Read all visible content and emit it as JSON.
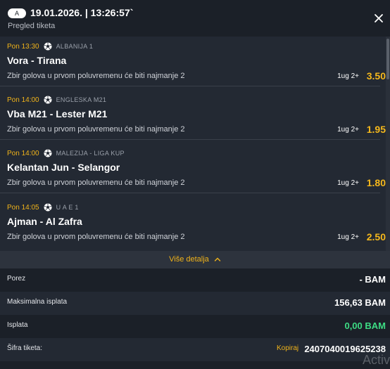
{
  "header": {
    "badge": "A",
    "datetime": "19.01.2026. | 13:26:57`",
    "subtitle": "Pregled tiketa"
  },
  "matches": [
    {
      "time": "Pon 13:30",
      "league": "ALBANIJA 1",
      "teams": "Vora - Tirana",
      "market": "Zbir golova u prvom poluvremenu će biti najmanje 2",
      "pick": "1ug 2+",
      "odd": "3.50"
    },
    {
      "time": "Pon 14:00",
      "league": "ENGLESKA M21",
      "teams": "Vba M21 - Lester M21",
      "market": "Zbir golova u prvom poluvremenu će biti najmanje 2",
      "pick": "1ug 2+",
      "odd": "1.95"
    },
    {
      "time": "Pon 14:00",
      "league": "MALEZIJA - LIGA KUP",
      "teams": "Kelantan Jun - Selangor",
      "market": "Zbir golova u prvom poluvremenu će biti najmanje 2",
      "pick": "1ug 2+",
      "odd": "1.80"
    },
    {
      "time": "Pon 14:05",
      "league": "U A E 1",
      "teams": "Ajman - Al Zafra",
      "market": "Zbir golova u prvom poluvremenu će biti najmanje 2",
      "pick": "1ug 2+",
      "odd": "2.50"
    }
  ],
  "details": {
    "label": "Više detalja"
  },
  "summary": {
    "tax_label": "Porez",
    "tax_value": "- BAM",
    "max_payout_label": "Maksimalna isplata",
    "max_payout_value": "156,63 BAM",
    "payout_label": "Isplata",
    "payout_value": "0,00 BAM",
    "code_label": "Šifra tiketa:",
    "copy_label": "Kopiraj",
    "code_value": "2407040019625238"
  },
  "watermark": "Activ",
  "colors": {
    "accent": "#f0b31a",
    "odd": "#f5b81c",
    "payout_zero": "#3ddc84",
    "background": "#1b2028",
    "panel": "#232933"
  },
  "icons": {
    "close": "close-icon",
    "sport": "soccer-ball-icon",
    "details": "chevron-up-icon"
  }
}
